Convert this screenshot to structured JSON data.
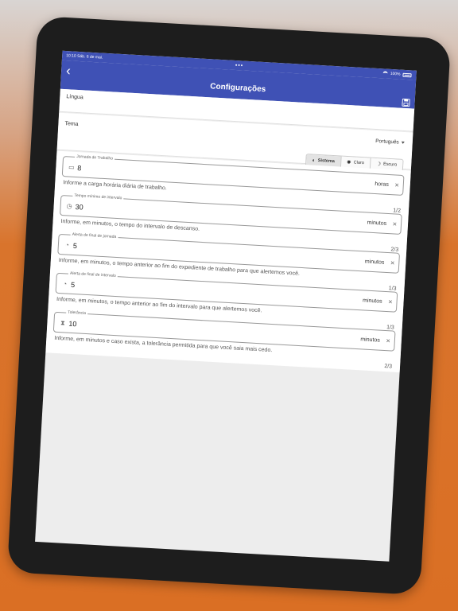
{
  "status": {
    "time": "10:10",
    "date": "Sáb. 6 de mai.",
    "battery": "100%"
  },
  "appbar": {
    "title": "Configurações",
    "dots": "•••"
  },
  "settings": {
    "language_label": "Língua",
    "theme_label": "Tema",
    "theme_value": "Português",
    "theme_options": [
      {
        "label": "Sistema",
        "icon": "◐",
        "active": true
      },
      {
        "label": "Claro",
        "icon": "✹",
        "active": false
      },
      {
        "label": "Escuro",
        "icon": "☽",
        "active": false
      }
    ]
  },
  "fields": [
    {
      "label": "Jornada de Trabalho",
      "icon": "briefcase-icon",
      "glyph": "▭",
      "value": "8",
      "unit": "horas",
      "helper": "Informe a carga horária diária de trabalho.",
      "counter": "1/2"
    },
    {
      "label": "Tempo mínimo de intervalo",
      "icon": "timer-icon",
      "glyph": "◷",
      "value": "30",
      "unit": "minutos",
      "helper": "Informe, em minutos, o tempo do intervalo de descanso.",
      "counter": "2/3"
    },
    {
      "label": "Alerta de final de jornada",
      "icon": "clock-icon",
      "glyph": "◔",
      "value": "5",
      "unit": "minutos",
      "helper": "Informe, em minutos, o tempo anterior ao fim do expediente de trabalho para que alertemos você.",
      "counter": "1/3"
    },
    {
      "label": "Alerta de final de intervalo",
      "icon": "clock-icon",
      "glyph": "◔",
      "value": "5",
      "unit": "minutos",
      "helper": "Informe, em minutos, o tempo anterior ao fim do intervalo para que alertemos você.",
      "counter": "1/3"
    },
    {
      "label": "Tolerância",
      "icon": "hourglass-icon",
      "glyph": "⧗",
      "value": "10",
      "unit": "minutos",
      "helper": "Informe, em minutos e caso exista, a tolerância permitida para que você saia mais cedo.",
      "counter": "2/3"
    }
  ],
  "colors": {
    "primary": "#3f51b5",
    "background_top": "#d9d5d3",
    "background_bottom": "#da6f24",
    "device": "#1d1d1d"
  }
}
